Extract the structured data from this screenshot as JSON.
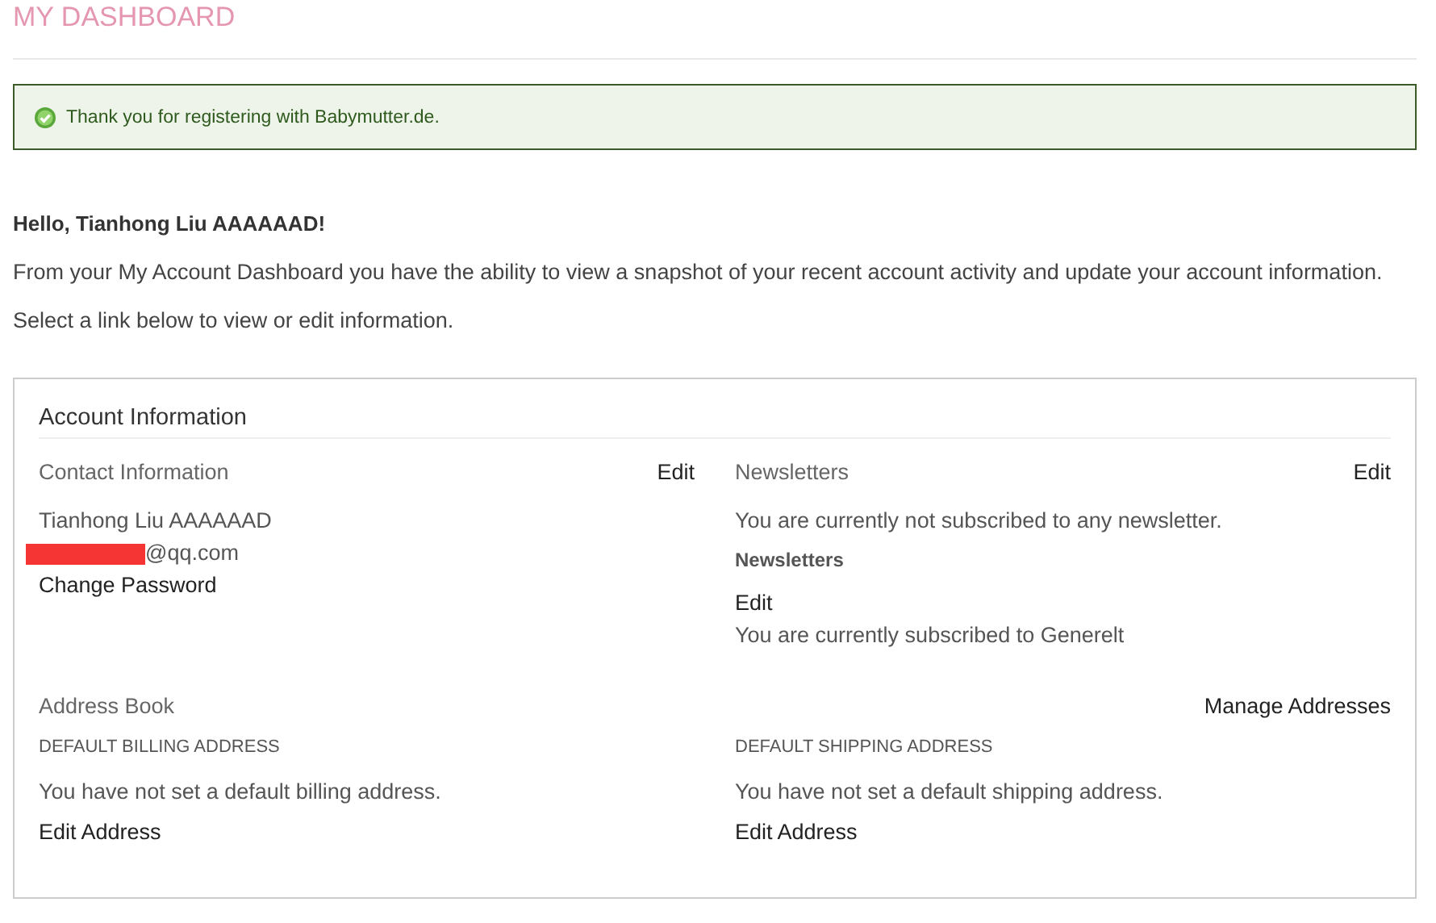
{
  "page_title": "MY DASHBOARD",
  "success_message": {
    "text": "Thank you for registering with Babymutter.de."
  },
  "greeting": "Hello, Tianhong Liu AAAAAAD!",
  "intro": "From your My Account Dashboard you have the ability to view a snapshot of your recent account activity and update your account information.",
  "instruction": "Select a link below to view or edit information.",
  "account_information": {
    "title": "Account Information",
    "contact": {
      "title": "Contact Information",
      "edit": "Edit",
      "name": "Tianhong Liu AAAAAAD",
      "email": "@qq.com",
      "email_redacted": true,
      "change_password": "Change Password"
    },
    "newsletters": {
      "title": "Newsletters",
      "edit": "Edit",
      "status": "You are currently not subscribed to any newsletter.",
      "subheading": "Newsletters",
      "sub_edit": "Edit",
      "subscription": "You are currently subscribed to Generelt"
    }
  },
  "address_book": {
    "title": "Address Book",
    "manage": "Manage Addresses",
    "columns": [
      {
        "heading": "DEFAULT BILLING ADDRESS",
        "text": "You have not set a default billing address.",
        "edit": "Edit Address"
      },
      {
        "heading": "DEFAULT SHIPPING ADDRESS",
        "text": "You have not set a default shipping address.",
        "edit": "Edit Address"
      }
    ]
  }
}
